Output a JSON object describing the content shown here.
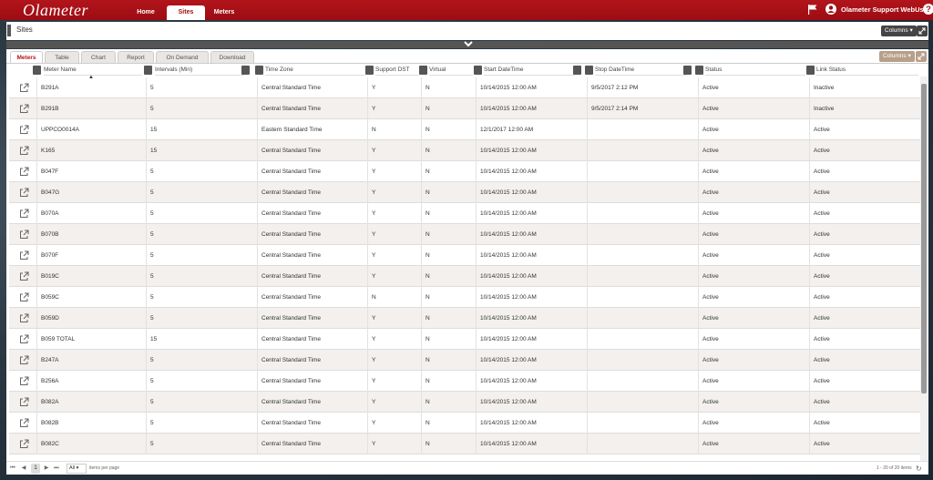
{
  "app": {
    "logo": "Olameter",
    "nav": [
      "Home",
      "Sites",
      "Meters"
    ],
    "active_nav": "Sites",
    "user": "Olameter Support WebUser",
    "help": "?"
  },
  "page": {
    "title": "Sites",
    "columns_button": "Columns ▾"
  },
  "panel": {
    "tabs": [
      "Meters",
      "Table",
      "Chart",
      "Report",
      "On Demand",
      "Download"
    ],
    "active_tab": "Meters",
    "columns_button": "Columns ▾"
  },
  "grid": {
    "headers": [
      "Meter Name",
      "Intervals (Min)",
      "Time Zone",
      "Support DST",
      "Virtual",
      "Start DateTime",
      "Stop DateTime",
      "Status",
      "Link Status"
    ],
    "rows": [
      [
        "B291A",
        "5",
        "Central Standard Time",
        "Y",
        "N",
        "10/14/2015 12:00 AM",
        "9/5/2017 2:12 PM",
        "Active",
        "Inactive"
      ],
      [
        "B291B",
        "5",
        "Central Standard Time",
        "Y",
        "N",
        "10/14/2015 12:00 AM",
        "9/5/2017 2:14 PM",
        "Active",
        "Inactive"
      ],
      [
        "UPPCO0014A",
        "15",
        "Eastern Standard Time",
        "N",
        "N",
        "12/1/2017 12:00 AM",
        "",
        "Active",
        "Active"
      ],
      [
        "K165",
        "15",
        "Central Standard Time",
        "Y",
        "N",
        "10/14/2015 12:00 AM",
        "",
        "Active",
        "Active"
      ],
      [
        "B047F",
        "5",
        "Central Standard Time",
        "Y",
        "N",
        "10/14/2015 12:00 AM",
        "",
        "Active",
        "Active"
      ],
      [
        "B047G",
        "5",
        "Central Standard Time",
        "Y",
        "N",
        "10/14/2015 12:00 AM",
        "",
        "Active",
        "Active"
      ],
      [
        "B070A",
        "5",
        "Central Standard Time",
        "Y",
        "N",
        "10/14/2015 12:00 AM",
        "",
        "Active",
        "Active"
      ],
      [
        "B070B",
        "5",
        "Central Standard Time",
        "Y",
        "N",
        "10/14/2015 12:00 AM",
        "",
        "Active",
        "Active"
      ],
      [
        "B070F",
        "5",
        "Central Standard Time",
        "Y",
        "N",
        "10/14/2015 12:00 AM",
        "",
        "Active",
        "Active"
      ],
      [
        "B019C",
        "5",
        "Central Standard Time",
        "Y",
        "N",
        "10/14/2015 12:00 AM",
        "",
        "Active",
        "Active"
      ],
      [
        "B059C",
        "5",
        "Central Standard Time",
        "N",
        "N",
        "10/14/2015 12:00 AM",
        "",
        "Active",
        "Active"
      ],
      [
        "B059D",
        "5",
        "Central Standard Time",
        "Y",
        "N",
        "10/14/2015 12:00 AM",
        "",
        "Active",
        "Active"
      ],
      [
        "B059 TOTAL",
        "15",
        "Central Standard Time",
        "Y",
        "N",
        "10/14/2015 12:00 AM",
        "",
        "Active",
        "Active"
      ],
      [
        "B247A",
        "5",
        "Central Standard Time",
        "Y",
        "N",
        "10/14/2015 12:00 AM",
        "",
        "Active",
        "Active"
      ],
      [
        "B256A",
        "5",
        "Central Standard Time",
        "Y",
        "N",
        "10/14/2015 12:00 AM",
        "",
        "Active",
        "Active"
      ],
      [
        "B082A",
        "5",
        "Central Standard Time",
        "Y",
        "N",
        "10/14/2015 12:00 AM",
        "",
        "Active",
        "Active"
      ],
      [
        "B082B",
        "5",
        "Central Standard Time",
        "Y",
        "N",
        "10/14/2015 12:00 AM",
        "",
        "Active",
        "Active"
      ],
      [
        "B082C",
        "5",
        "Central Standard Time",
        "Y",
        "N",
        "10/14/2015 12:00 AM",
        "",
        "Active",
        "Active"
      ]
    ]
  },
  "pager": {
    "first": "⏮",
    "prev": "◀",
    "current_page": "1",
    "next": "▶",
    "last": "⏭",
    "per_page_value": "All",
    "per_page_label": "items per page",
    "info": "1 - 20 of 20 items",
    "refresh": "↻"
  },
  "icons": {
    "flag": "flag-icon",
    "user": "user-icon",
    "edit": "external-link-icon",
    "filter": "filter-icon",
    "calendar": "calendar-icon"
  },
  "colors": {
    "brand_red": "#b3141b",
    "accent_tan": "#b79f8a",
    "dark_bar": "#555555",
    "alt_row": "#f3f0ed"
  }
}
